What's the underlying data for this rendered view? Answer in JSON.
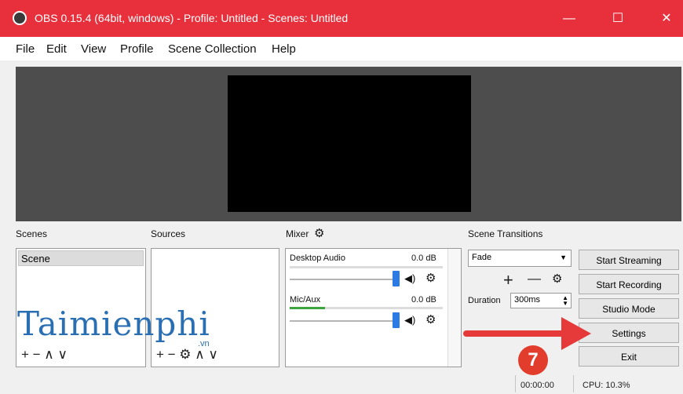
{
  "window": {
    "title": "OBS 0.15.4 (64bit, windows) - Profile: Untitled - Scenes: Untitled",
    "minimize": "—",
    "maximize": "☐",
    "close": "✕"
  },
  "menu": [
    "File",
    "Edit",
    "View",
    "Profile",
    "Scene Collection",
    "Help"
  ],
  "docks": {
    "scenes": {
      "label": "Scenes",
      "items": [
        "Scene"
      ],
      "toolbar": "+ −   ∧ ∨"
    },
    "sources": {
      "label": "Sources",
      "toolbar": "+ − ⚙ ∧ ∨"
    },
    "mixer": {
      "label": "Mixer",
      "channels": [
        {
          "name": "Desktop Audio",
          "db": "0.0 dB"
        },
        {
          "name": "Mic/Aux",
          "db": "0.0 dB"
        }
      ],
      "speaker_glyph": "◀)",
      "gear_glyph": "⚙"
    },
    "transitions": {
      "label": "Scene Transitions",
      "selected": "Fade",
      "add": "+",
      "remove": "—",
      "settings": "⚙",
      "duration_label": "Duration",
      "duration_value": "300ms"
    }
  },
  "controls": [
    "Start Streaming",
    "Start Recording",
    "Studio Mode",
    "Settings",
    "Exit"
  ],
  "status": {
    "time": "00:00:00",
    "cpu": "CPU: 10.3%"
  },
  "overlay": {
    "watermark": "Taimienphi",
    "watermark_sub": ".vn",
    "step_number": "7"
  },
  "colors": {
    "titlebar": "#e8303c",
    "accent": "#2c7be5",
    "arrow": "#e63a3a"
  }
}
